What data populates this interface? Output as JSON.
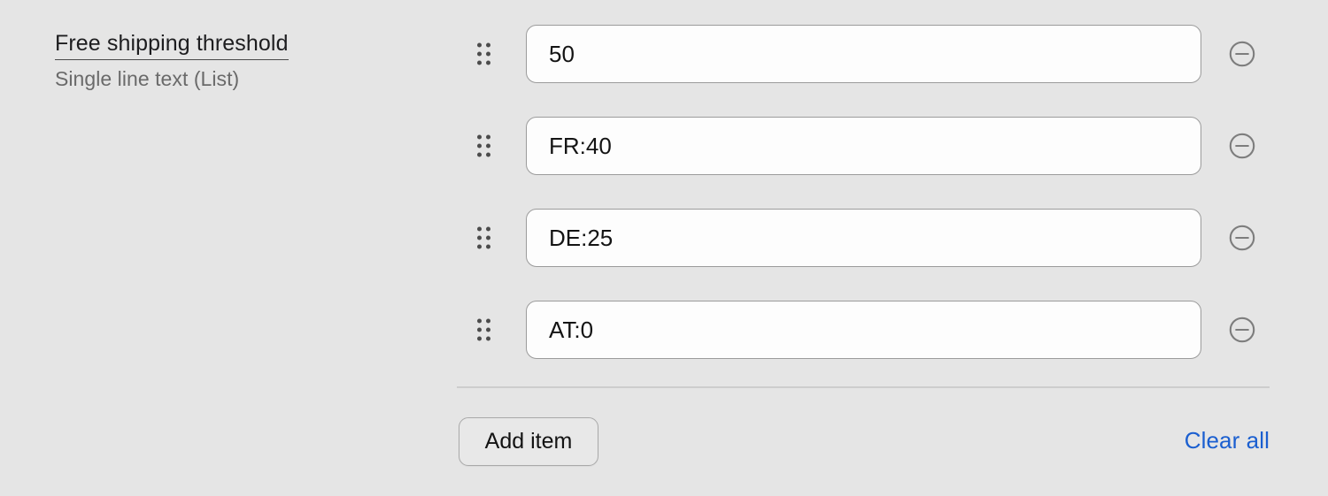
{
  "field": {
    "title": "Free shipping threshold",
    "subtitle": "Single line text (List)"
  },
  "items": [
    {
      "value": "50",
      "placeholder": "",
      "drag_handle": "drag-handle-icon",
      "remove": "remove-circle-icon"
    },
    {
      "value": "FR:40",
      "placeholder": "",
      "drag_handle": "drag-handle-icon",
      "remove": "remove-circle-icon"
    },
    {
      "value": "DE:25",
      "placeholder": "",
      "drag_handle": "drag-handle-icon",
      "remove": "remove-circle-icon"
    },
    {
      "value": "AT:0",
      "placeholder": "",
      "drag_handle": "drag-handle-icon",
      "remove": "remove-circle-icon"
    }
  ],
  "footer": {
    "add_item_label": "Add item",
    "clear_all_label": "Clear all"
  },
  "colors": {
    "background": "#e5e5e5",
    "input_background": "#fdfdfd",
    "input_border": "#9b9b9b",
    "text": "#141414",
    "subtitle": "#6a6a6a",
    "link": "#1b5fd0",
    "divider": "#cdcdcd",
    "icon": "#7d7d7d"
  }
}
